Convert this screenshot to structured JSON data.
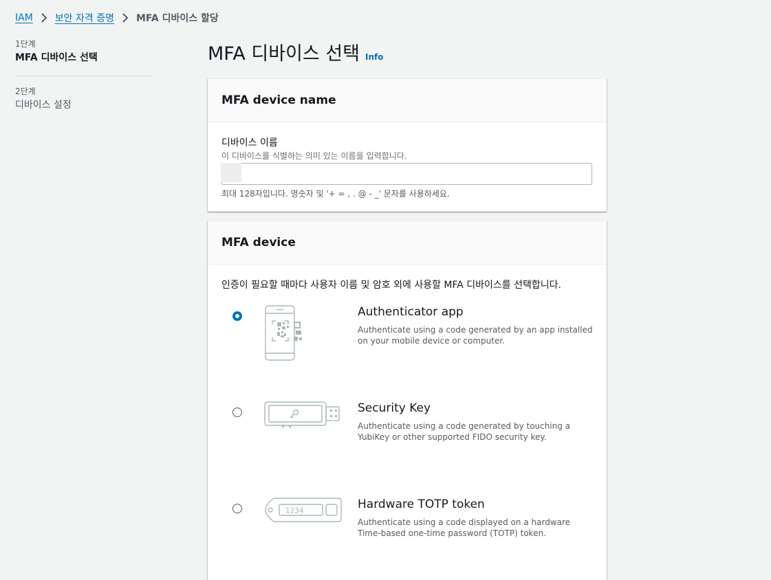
{
  "breadcrumb": {
    "iam": "IAM",
    "security_credentials": "보안 자격 증명",
    "current": "MFA 디바이스 할당"
  },
  "steps": [
    {
      "num": "1단계",
      "title": "MFA 디바이스 선택"
    },
    {
      "num": "2단계",
      "title": "디바이스 설정"
    }
  ],
  "page": {
    "title": "MFA 디바이스 선택",
    "info": "Info"
  },
  "name_panel": {
    "heading": "MFA device name",
    "label": "디바이스 이름",
    "description": "이 디바이스를 식별하는 의미 있는 이름을 입력합니다.",
    "value": "",
    "hint": "최대 128자입니다. 영숫자 및 '+ = , . @ - _' 문자를 사용하세요."
  },
  "device_panel": {
    "heading": "MFA device",
    "intro": "인증이 필요할 때마다 사용자 이름 및 암호 외에 사용할 MFA 디바이스를 선택합니다.",
    "options": [
      {
        "title": "Authenticator app",
        "desc": "Authenticate using a code generated by an app installed on your mobile device or computer.",
        "selected": true,
        "icon": "authenticator-app-icon"
      },
      {
        "title": "Security Key",
        "desc": "Authenticate using a code generated by touching a YubiKey or other supported FIDO security key.",
        "selected": false,
        "icon": "security-key-icon"
      },
      {
        "title": "Hardware TOTP token",
        "desc": "Authenticate using a code displayed on a hardware Time-based one-time password (TOTP) token.",
        "selected": false,
        "icon": "hardware-token-icon",
        "token_display": "1234"
      }
    ]
  },
  "colors": {
    "link": "#0073bb",
    "background": "#f2f3f3",
    "illustration": "#aab7b8"
  }
}
